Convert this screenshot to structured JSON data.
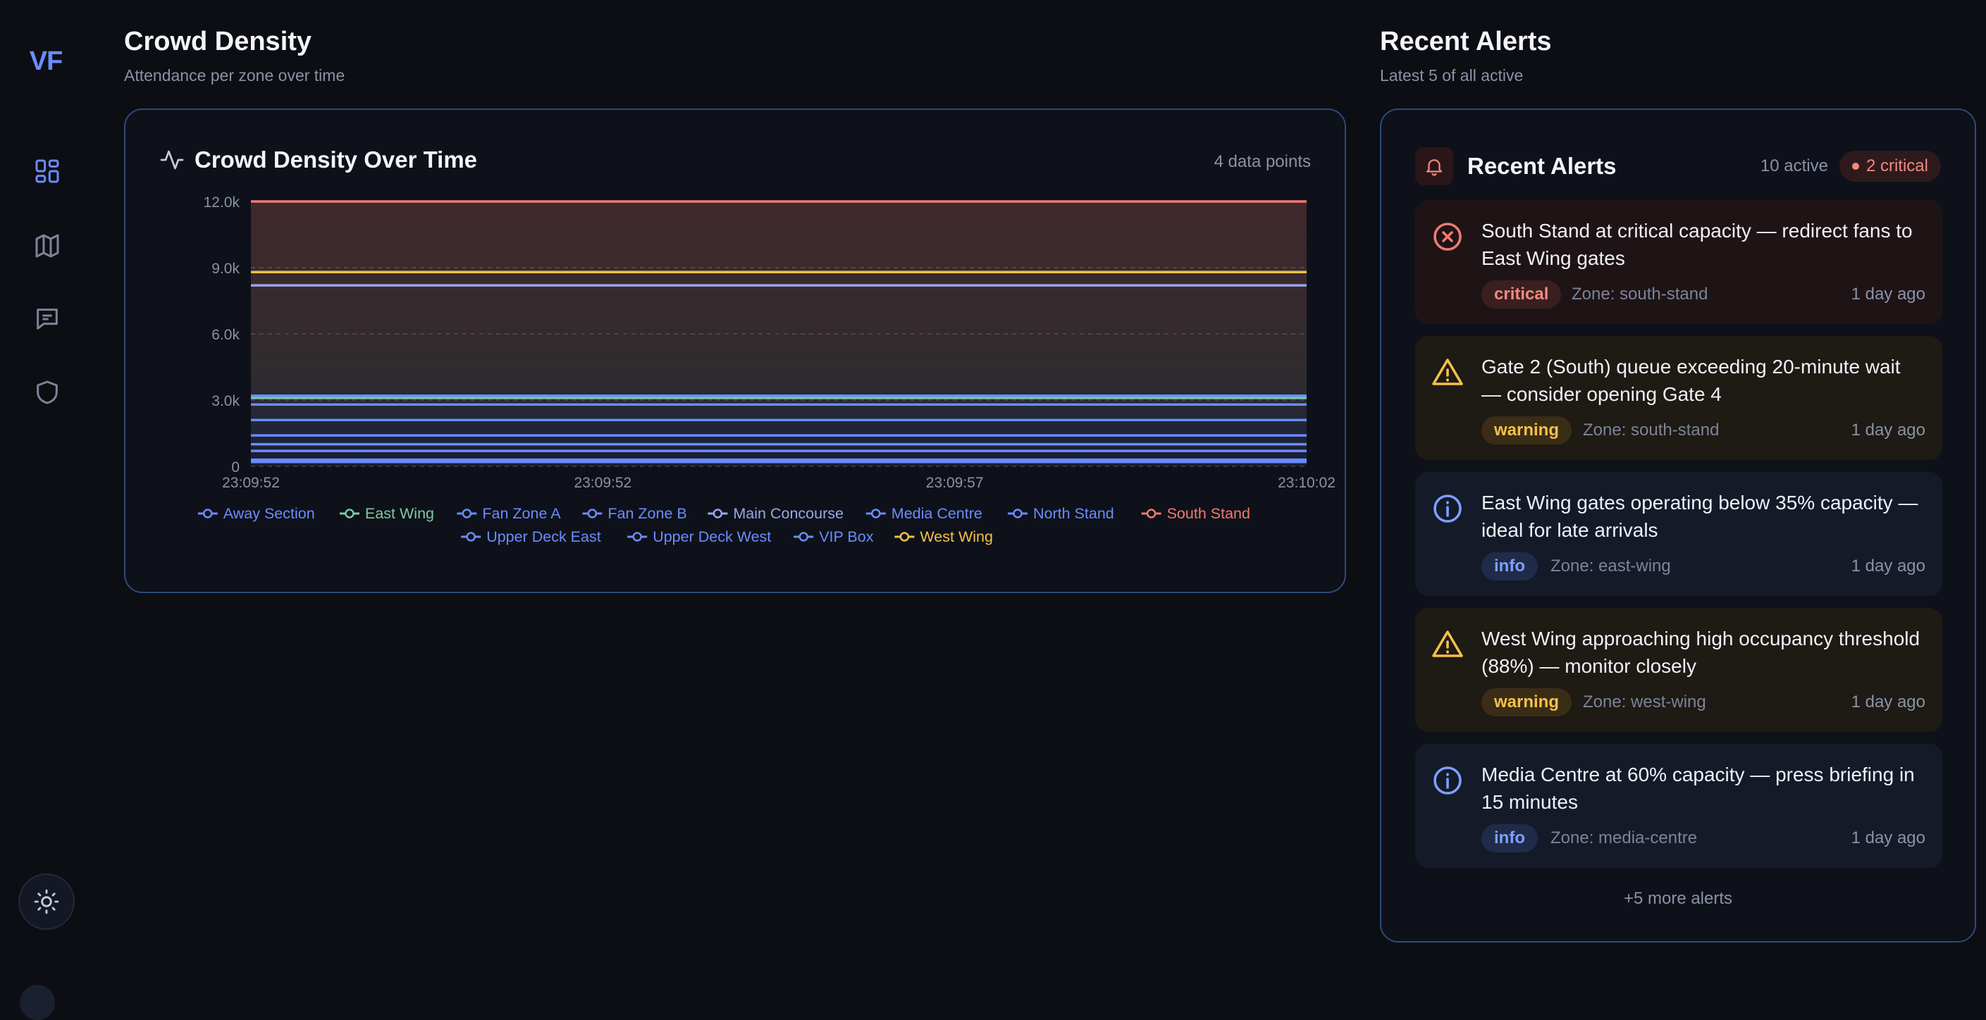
{
  "sidebar": {
    "logo": "VF",
    "items": [
      {
        "name": "dashboard-icon",
        "active": true
      },
      {
        "name": "map-icon"
      },
      {
        "name": "chat-icon"
      },
      {
        "name": "shield-icon"
      }
    ],
    "theme_icon": "sun-icon"
  },
  "crowd": {
    "title": "Crowd Density",
    "subtitle": "Attendance per zone over time",
    "card_title": "Crowd Density Over Time",
    "data_points": "4 data points"
  },
  "chart_data": {
    "type": "area",
    "title": "Crowd Density Over Time",
    "x": [
      "23:09:52",
      "23:09:52",
      "23:09:57",
      "23:10:02"
    ],
    "ylim": [
      0,
      12000
    ],
    "y_ticks": [
      "0",
      "3.0k",
      "6.0k",
      "9.0k",
      "12.0k"
    ],
    "grid": true,
    "legend_position": "bottom",
    "series": [
      {
        "name": "Away Section",
        "color": "#6b8cff",
        "values": [
          700,
          700,
          700,
          700
        ]
      },
      {
        "name": "East Wing",
        "color": "#7fc8a0",
        "values": [
          3100,
          3100,
          3100,
          3100
        ]
      },
      {
        "name": "Fan Zone A",
        "color": "#6b8cff",
        "values": [
          2100,
          2100,
          2100,
          2100
        ]
      },
      {
        "name": "Fan Zone B",
        "color": "#6b8cff",
        "values": [
          1400,
          1400,
          1400,
          1400
        ]
      },
      {
        "name": "Main Concourse",
        "color": "#9aa6e8",
        "values": [
          8200,
          8200,
          8200,
          8200
        ]
      },
      {
        "name": "Media Centre",
        "color": "#6b8cff",
        "values": [
          300,
          300,
          300,
          300
        ]
      },
      {
        "name": "North Stand",
        "color": "#6b8cff",
        "values": [
          3200,
          3200,
          3200,
          3200
        ]
      },
      {
        "name": "South Stand",
        "color": "#f07a70",
        "values": [
          12000,
          12000,
          12000,
          12000
        ]
      },
      {
        "name": "Upper Deck East",
        "color": "#6b8cff",
        "values": [
          2800,
          2800,
          2800,
          2800
        ]
      },
      {
        "name": "Upper Deck West",
        "color": "#6b8cff",
        "values": [
          1000,
          1000,
          1000,
          1000
        ]
      },
      {
        "name": "VIP Box",
        "color": "#6b8cff",
        "values": [
          200,
          200,
          200,
          200
        ]
      },
      {
        "name": "West Wing",
        "color": "#f5c04a",
        "values": [
          8800,
          8800,
          8800,
          8800
        ]
      }
    ]
  },
  "alerts_section": {
    "title": "Recent Alerts",
    "subtitle": "Latest 5 of all active",
    "card_title": "Recent Alerts",
    "active_count": "10 active",
    "critical_count": "2 critical",
    "more": "+5 more alerts"
  },
  "alerts": [
    {
      "severity": "critical",
      "message": "South Stand at critical capacity — redirect fans to East Wing gates",
      "badge": "critical",
      "zone": "Zone: south-stand",
      "time": "1 day ago",
      "icon": "x-circle-icon"
    },
    {
      "severity": "warning",
      "message": "Gate 2 (South) queue exceeding 20-minute wait — consider opening Gate 4",
      "badge": "warning",
      "zone": "Zone: south-stand",
      "time": "1 day ago",
      "icon": "warning-triangle-icon"
    },
    {
      "severity": "info",
      "message": "East Wing gates operating below 35% capacity — ideal for late arrivals",
      "badge": "info",
      "zone": "Zone: east-wing",
      "time": "1 day ago",
      "icon": "info-circle-icon"
    },
    {
      "severity": "warning",
      "message": "West Wing approaching high occupancy threshold (88%) — monitor closely",
      "badge": "warning",
      "zone": "Zone: west-wing",
      "time": "1 day ago",
      "icon": "warning-triangle-icon"
    },
    {
      "severity": "info",
      "message": "Media Centre at 60% capacity — press briefing in 15 minutes",
      "badge": "info",
      "zone": "Zone: media-centre",
      "time": "1 day ago",
      "icon": "info-circle-icon"
    }
  ]
}
